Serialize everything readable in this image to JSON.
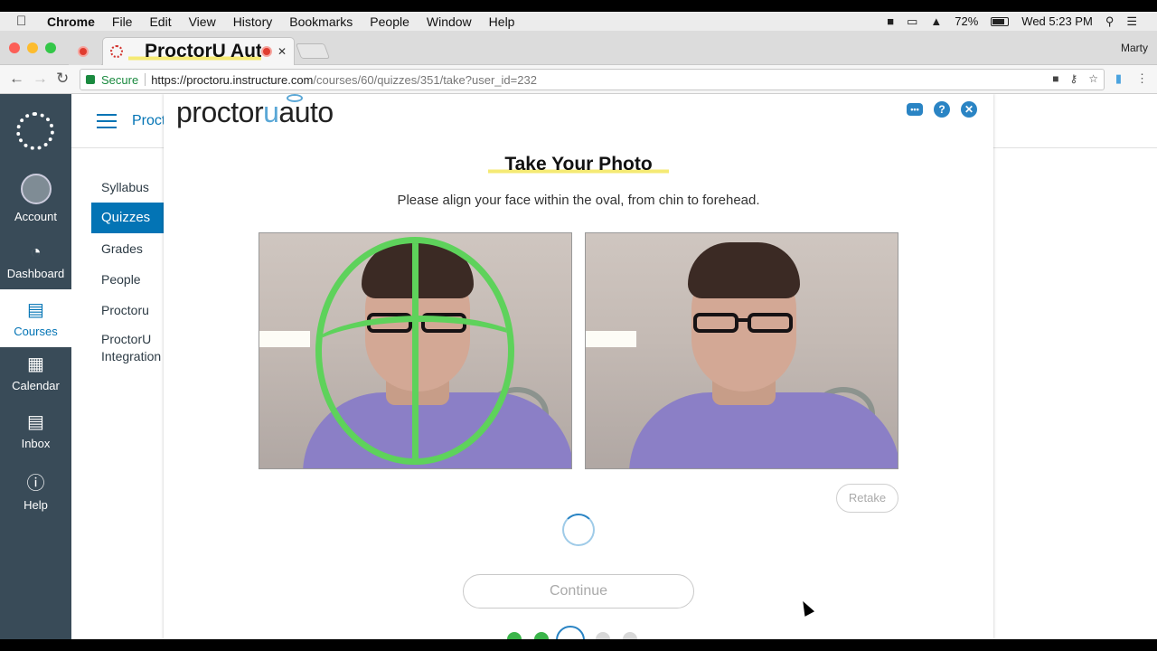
{
  "menubar": {
    "apple_icon": "apple-icon",
    "items": [
      "Chrome",
      "File",
      "Edit",
      "View",
      "History",
      "Bookmarks",
      "People",
      "Window",
      "Help"
    ],
    "battery": "72%",
    "clock": "Wed 5:23 PM"
  },
  "browser": {
    "tab_title": "ProctorU Auto - Canvas Dev",
    "profile": "Marty",
    "secure_label": "Secure",
    "url_host": "https://proctoru.instructure.com",
    "url_path": "/courses/60/quizzes/351/take?user_id=232"
  },
  "global_nav": {
    "items": [
      {
        "label": "Account",
        "icon": "avatar"
      },
      {
        "label": "Dashboard",
        "icon": "dashboard-icon"
      },
      {
        "label": "Courses",
        "icon": "courses-icon"
      },
      {
        "label": "Calendar",
        "icon": "calendar-icon"
      },
      {
        "label": "Inbox",
        "icon": "inbox-icon"
      },
      {
        "label": "Help",
        "icon": "help-icon"
      }
    ],
    "active": "Courses",
    "color_bg": "#394b58",
    "color_accent": "#0374b5"
  },
  "course": {
    "breadcrumb": "Procto",
    "nav": [
      "Syllabus",
      "Quizzes",
      "Grades",
      "People",
      "Proctoru",
      "ProctorU Integration"
    ],
    "active": "Quizzes"
  },
  "proctor": {
    "logo_left": "proctor",
    "logo_u": "u",
    "logo_right": "auto",
    "title": "Take Your Photo",
    "instructions": "Please align your face within the oval, from chin to forehead.",
    "retake_label": "Retake",
    "continue_label": "Continue",
    "steps": [
      "done",
      "done",
      "current",
      "pending",
      "pending"
    ],
    "color_oval": "#5ed25b",
    "color_highlight": "#f5ea74"
  }
}
